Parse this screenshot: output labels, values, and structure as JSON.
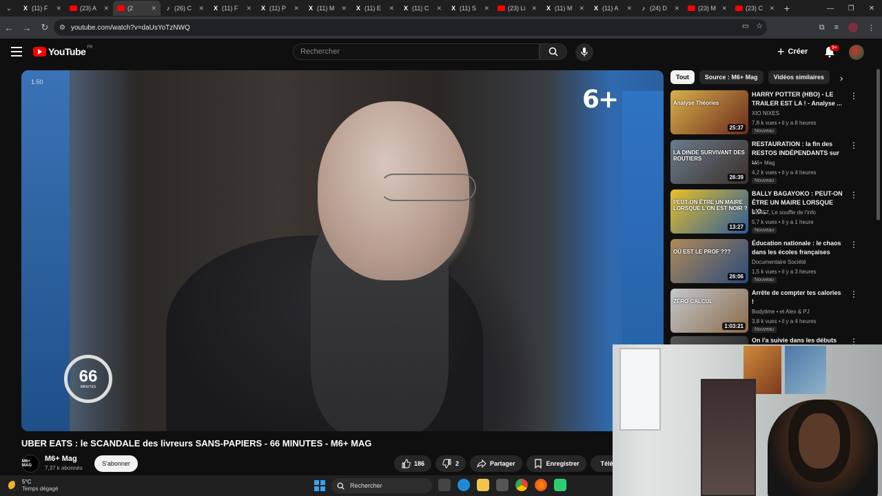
{
  "browser": {
    "tabs": [
      {
        "icon": "x",
        "title": "(11) F"
      },
      {
        "icon": "yt",
        "title": "(23) A"
      },
      {
        "icon": "yt",
        "title": "(2"
      },
      {
        "icon": "tk",
        "title": "(26) C"
      },
      {
        "icon": "x",
        "title": "(11) F"
      },
      {
        "icon": "x",
        "title": "(11) P"
      },
      {
        "icon": "x",
        "title": "(11) M"
      },
      {
        "icon": "x",
        "title": "(11) E"
      },
      {
        "icon": "x",
        "title": "(11) C"
      },
      {
        "icon": "x",
        "title": "(11) S"
      },
      {
        "icon": "yt",
        "title": "(23) Li"
      },
      {
        "icon": "x",
        "title": "(11) M"
      },
      {
        "icon": "x",
        "title": "(11) A"
      },
      {
        "icon": "tk",
        "title": "(24) D"
      },
      {
        "icon": "yt",
        "title": "(23) M"
      },
      {
        "icon": "yt",
        "title": "(23) C"
      }
    ],
    "url": "youtube.com/watch?v=daUsYoTzNWQ"
  },
  "youtube": {
    "logo_text": "YouTube",
    "region": "FR",
    "search_placeholder": "Rechercher",
    "create_label": "Créer",
    "notif_count": "9+"
  },
  "video": {
    "time_label": "1.50",
    "watermark": "6+",
    "badge_number": "66",
    "badge_sub": "MINUTES",
    "title": "UBER EATS : le SCANDALE des livreurs SANS-PAPIERS - 66 MINUTES - M6+ MAG",
    "channel": "M6+ Mag",
    "channel_logo_text": "M6+ MAG",
    "subscribers": "7,37 k abonnés",
    "subscribe_label": "S'abonner",
    "likes": "186",
    "dislikes": "2",
    "share_label": "Partager",
    "save_label": "Enregistrer",
    "download_label": "Téléc"
  },
  "sidebar": {
    "chips": [
      "Tout",
      "Source : M6+ Mag",
      "Vidéos similaires"
    ],
    "recommendations": [
      {
        "title": "HARRY POTTER (HBO) - LE TRAILER EST LA ! - Analyse ...",
        "channel": "XIO NIXES",
        "meta": "7,8 k vues • il y a 8 heures",
        "badge": "Nouveau",
        "duration": "25:37",
        "thumb_text": "Analyse Théories",
        "colors": [
          "#d8b04a",
          "#6b2b1e"
        ]
      },
      {
        "title": "RESTAURATION : la fin des RESTOS INDÉPENDANTS sur ...",
        "channel": "M6+ Mag",
        "meta": "4,2 k vues • il y a 4 heures",
        "badge": "Nouveau",
        "duration": "26:39",
        "thumb_text": "LA DINDE SURVIVANT DES ROUTIERS",
        "colors": [
          "#6a7c8c",
          "#3b2f2a"
        ]
      },
      {
        "title": "BALLY BAGAYOKO : PEUT-ON ÊTRE UN MAIRE LORSQUE L'O...",
        "channel": "BLAST, Le souffle de l'info",
        "meta": "5,7 k vues • il y a 1 heure",
        "badge": "Nouveau",
        "duration": "13:27",
        "thumb_text": "PEUT-ON ÊTRE UN MAIRE LORSQUE L'ON EST NOIR ?",
        "colors": [
          "#e8c02a",
          "#2a5a9a"
        ]
      },
      {
        "title": "Éducation nationale : le chaos dans les écoles françaises",
        "channel": "Documentaire Société",
        "meta": "1,5 k vues • il y a 3 heures",
        "badge": "Nouveau",
        "duration": "26:06",
        "thumb_text": "OÙ EST LE PROF ???",
        "colors": [
          "#b08a5a",
          "#2a4a7a"
        ]
      },
      {
        "title": "Arrête de compter tes calories !",
        "channel": "Bodytime • et Alex & PJ",
        "meta": "3,8 k vues • il y a 4 heures",
        "badge": "Nouveau",
        "duration": "1:03:21",
        "thumb_text": "ZÉRO CALCUL",
        "colors": [
          "#c4c8cc",
          "#8a6a4a"
        ]
      },
      {
        "title": "On l'a suivie dans les débuts de",
        "channel": "",
        "meta": "",
        "badge": "",
        "duration": "",
        "thumb_text": "",
        "colors": [
          "#555",
          "#222"
        ]
      }
    ]
  },
  "taskbar": {
    "temp": "5°C",
    "weather": "Temps dégagé",
    "search_label": "Rechercher"
  }
}
